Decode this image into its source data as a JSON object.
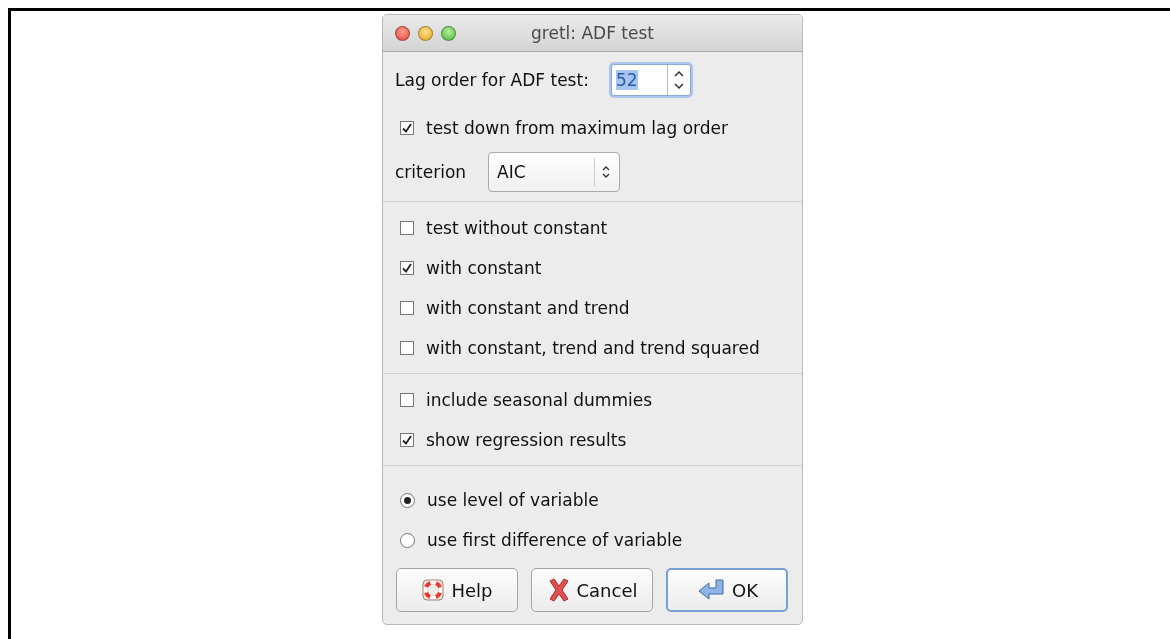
{
  "window": {
    "title": "gretl: ADF test"
  },
  "lag_order": {
    "label": "Lag order for ADF test:",
    "value": "52"
  },
  "test_down": {
    "label": "test down from maximum lag order",
    "checked": true
  },
  "criterion": {
    "label": "criterion",
    "value": "AIC"
  },
  "model_options": [
    {
      "label": "test without constant",
      "checked": false
    },
    {
      "label": "with constant",
      "checked": true
    },
    {
      "label": "with constant and trend",
      "checked": false
    },
    {
      "label": "with constant, trend and trend squared",
      "checked": false
    }
  ],
  "extra_options": [
    {
      "label": "include seasonal dummies",
      "checked": false
    },
    {
      "label": "show regression results",
      "checked": true
    }
  ],
  "variable_choice": [
    {
      "label": "use level of variable",
      "selected": true
    },
    {
      "label": "use first difference of variable",
      "selected": false
    }
  ],
  "buttons": [
    {
      "label": "Help",
      "kind": "help"
    },
    {
      "label": "Cancel",
      "kind": "cancel"
    },
    {
      "label": "OK",
      "kind": "ok"
    }
  ]
}
